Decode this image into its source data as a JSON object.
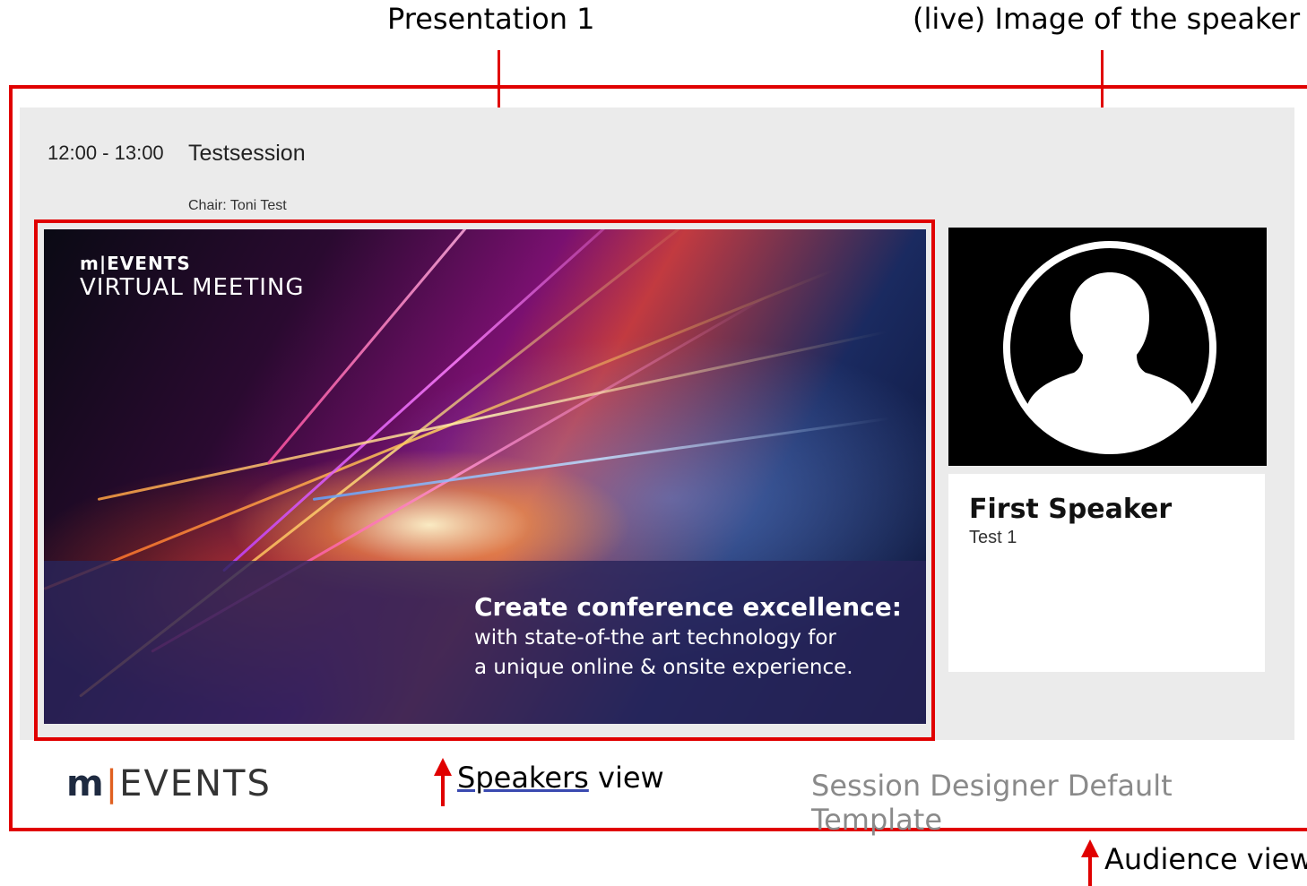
{
  "annotations": {
    "presentation": "Presentation 1",
    "speaker_image": "(live) Image of the speaker",
    "speakers_view_word1": "Speakers",
    "speakers_view_word2": " view",
    "audience_view": "Audience view"
  },
  "session": {
    "time": "12:00 - 13:00",
    "title": "Testsession",
    "chair": "Chair: Toni Test"
  },
  "slide": {
    "brand": "m|EVENTS",
    "title": "VIRTUAL MEETING",
    "headline": "Create conference excellence:",
    "line1": "with state-of-the art technology for",
    "line2": "a unique online & onsite experience."
  },
  "speaker": {
    "name": "First Speaker",
    "subtitle": "Test 1"
  },
  "footer": {
    "logo_m": "m",
    "logo_bar": "|",
    "logo_text": "EVENTS",
    "template": "Session Designer Default Template"
  },
  "colors": {
    "annotation_red": "#e00000",
    "stage_gray": "#ebebeb"
  }
}
